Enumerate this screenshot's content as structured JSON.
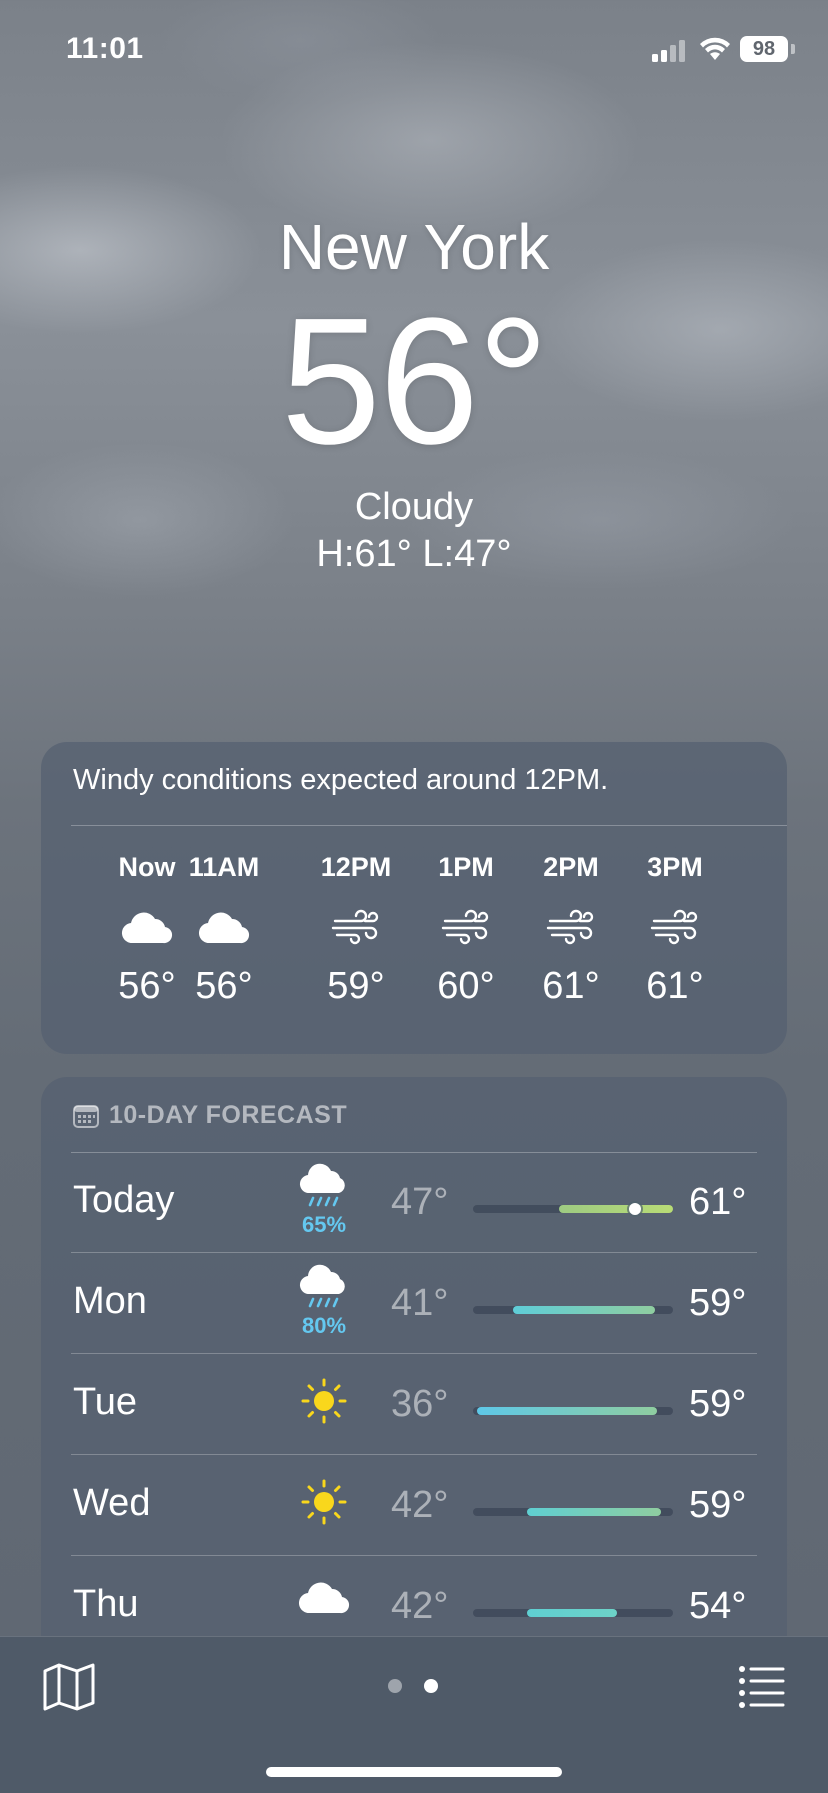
{
  "status": {
    "time": "11:01",
    "battery": "98"
  },
  "location": {
    "city": "New York",
    "temperature": "56°",
    "condition": "Cloudy",
    "high_low": "H:61°  L:47°"
  },
  "hourly": {
    "alert": "Windy conditions expected around 12PM.",
    "hours": [
      {
        "label": "Now",
        "icon": "cloud-icon",
        "temp": "56°"
      },
      {
        "label": "11AM",
        "icon": "cloud-icon",
        "temp": "56°"
      },
      {
        "label": "12PM",
        "icon": "wind-icon",
        "temp": "59°"
      },
      {
        "label": "1PM",
        "icon": "wind-icon",
        "temp": "60°"
      },
      {
        "label": "2PM",
        "icon": "wind-icon",
        "temp": "61°"
      },
      {
        "label": "3PM",
        "icon": "wind-icon",
        "temp": "61°"
      }
    ]
  },
  "daily": {
    "header": "10-DAY FORECAST",
    "days": [
      {
        "day": "Today",
        "icon": "cloud-rain-icon",
        "precip": "65%",
        "low": "47°",
        "high": "61°",
        "bar_start": 0.43,
        "bar_end": 1.0,
        "bar_colors": [
          "#9ecb82",
          "#b9dc76"
        ],
        "current": 0.81
      },
      {
        "day": "Mon",
        "icon": "cloud-rain-icon",
        "precip": "80%",
        "low": "41°",
        "high": "59°",
        "bar_start": 0.2,
        "bar_end": 0.91,
        "bar_colors": [
          "#5fcdd8",
          "#8fcda0"
        ]
      },
      {
        "day": "Tue",
        "icon": "sun-icon",
        "precip": "",
        "low": "36°",
        "high": "59°",
        "bar_start": 0.02,
        "bar_end": 0.92,
        "bar_colors": [
          "#5ec8e8",
          "#8fcda0"
        ]
      },
      {
        "day": "Wed",
        "icon": "sun-icon",
        "precip": "",
        "low": "42°",
        "high": "59°",
        "bar_start": 0.27,
        "bar_end": 0.94,
        "bar_colors": [
          "#5fcfd2",
          "#8fcda0"
        ]
      },
      {
        "day": "Thu",
        "icon": "cloud-icon",
        "precip": "",
        "low": "42°",
        "high": "54°",
        "bar_start": 0.27,
        "bar_end": 0.72,
        "bar_colors": [
          "#5fcfd2",
          "#6dd3c8"
        ]
      }
    ]
  },
  "tabbar": {
    "pages": 2,
    "active_page": 1
  }
}
